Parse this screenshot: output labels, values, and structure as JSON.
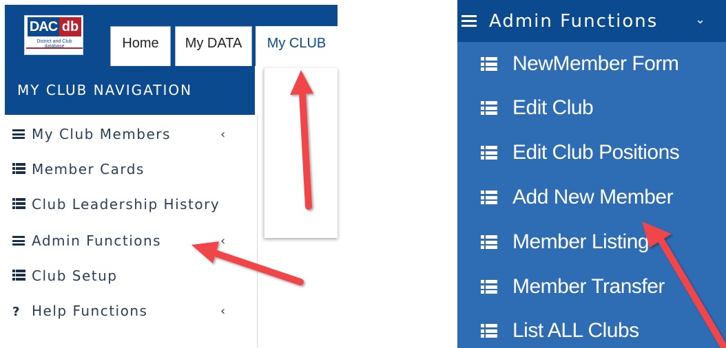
{
  "left": {
    "logo": {
      "main": "DAC",
      "accent": "db",
      "subtitle": "District and Club database"
    },
    "tabs": [
      {
        "label": "Home"
      },
      {
        "label": "My DATA"
      },
      {
        "label": "My CLUB"
      }
    ],
    "nav_title": "MY CLUB NAVIGATION",
    "nav_items": [
      {
        "label": "My Club Members",
        "icon": "bars-icon",
        "chevron": "‹"
      },
      {
        "label": "Member Cards",
        "icon": "list-icon"
      },
      {
        "label": "Club Leadership History",
        "icon": "list-icon"
      },
      {
        "label": "Admin Functions",
        "icon": "bars-icon",
        "chevron": "‹"
      },
      {
        "label": "Club Setup",
        "icon": "list-icon"
      },
      {
        "label": "Help Functions",
        "icon": "question-icon",
        "chevron": "‹"
      }
    ]
  },
  "right": {
    "header": {
      "label": "Admin Functions",
      "icon": "bars-icon",
      "chevron": "⌄"
    },
    "items": [
      {
        "label": "NewMember Form",
        "icon": "list-icon"
      },
      {
        "label": "Edit Club",
        "icon": "list-icon"
      },
      {
        "label": "Edit Club Positions",
        "icon": "list-icon"
      },
      {
        "label": "Add New Member",
        "icon": "list-icon"
      },
      {
        "label": "Member Listing",
        "icon": "list-icon"
      },
      {
        "label": "Member Transfer",
        "icon": "list-icon"
      },
      {
        "label": "List ALL Clubs",
        "icon": "list-icon"
      }
    ]
  },
  "colors": {
    "brand_blue": "#0b4a8f",
    "submenu_blue": "#2e6db4",
    "brand_red": "#b9212d",
    "annotation_arrow": "#f0444a"
  }
}
